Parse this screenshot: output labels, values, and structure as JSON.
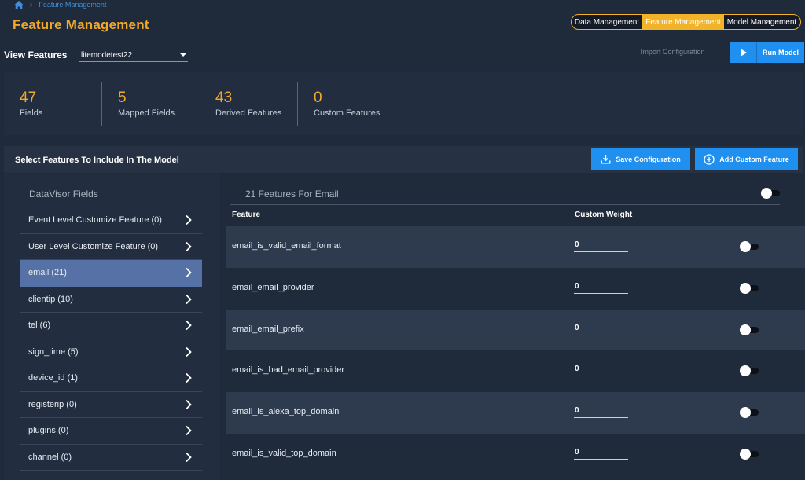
{
  "breadcrumb": {
    "current": "Feature Management"
  },
  "header": {
    "title": "Feature Management"
  },
  "management_tabs": [
    {
      "label": "Data Management"
    },
    {
      "label": "Feature Management"
    },
    {
      "label": "Model Management"
    }
  ],
  "view": {
    "label": "View Features",
    "selected": "litemodetest22"
  },
  "actions": {
    "import_label": "Import Configuration",
    "run_label": "Run Model"
  },
  "stats": [
    {
      "value": "47",
      "label": "Fields"
    },
    {
      "value": "5",
      "label": "Mapped Fields"
    },
    {
      "value": "43",
      "label": "Derived Features"
    },
    {
      "value": "0",
      "label": "Custom Features"
    }
  ],
  "select_section": {
    "title": "Select Features To Include In The Model",
    "save_label": "Save Configuration",
    "add_label": "Add Custom Feature"
  },
  "fields_panel": {
    "title": "DataVisor Fields",
    "items": [
      {
        "label": "Event Level Customize Feature (0)"
      },
      {
        "label": "User Level Customize Feature (0)"
      },
      {
        "label": "email (21)"
      },
      {
        "label": "clientip (10)"
      },
      {
        "label": "tel (6)"
      },
      {
        "label": "sign_time (5)"
      },
      {
        "label": "device_id (1)"
      },
      {
        "label": "registerip (0)"
      },
      {
        "label": "plugins (0)"
      },
      {
        "label": "channel (0)"
      }
    ],
    "active_index": 2
  },
  "features_panel": {
    "count_title": "21 Features For Email",
    "col_feature": "Feature",
    "col_weight": "Custom Weight",
    "rows": [
      {
        "name": "email_is_valid_email_format",
        "weight": "0",
        "enabled": false
      },
      {
        "name": "email_email_provider",
        "weight": "0",
        "enabled": false
      },
      {
        "name": "email_email_prefix",
        "weight": "0",
        "enabled": false
      },
      {
        "name": "email_is_bad_email_provider",
        "weight": "0",
        "enabled": false
      },
      {
        "name": "email_is_alexa_top_domain",
        "weight": "0",
        "enabled": false
      },
      {
        "name": "email_is_valid_top_domain",
        "weight": "0",
        "enabled": false
      }
    ]
  },
  "colors": {
    "accent": "#f1a92b",
    "primary": "#1f8ff0",
    "background": "#1f2a3a",
    "active_item": "#5571a6"
  }
}
